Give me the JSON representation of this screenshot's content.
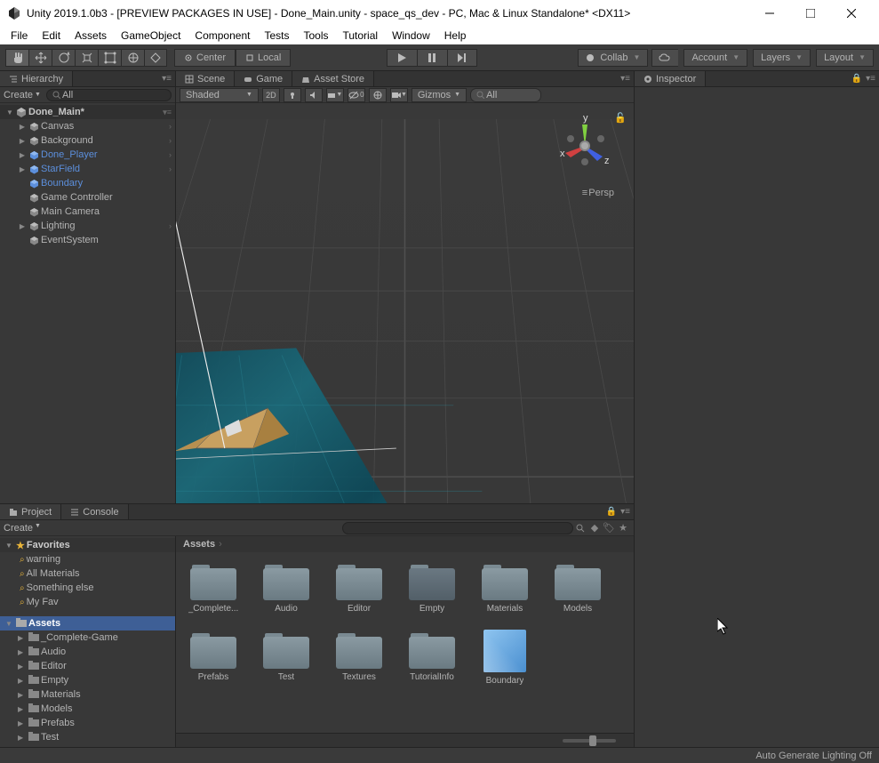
{
  "window": {
    "title": "Unity 2019.1.0b3 - [PREVIEW PACKAGES IN USE] - Done_Main.unity - space_qs_dev - PC, Mac & Linux Standalone* <DX11>"
  },
  "menu": [
    "File",
    "Edit",
    "Assets",
    "GameObject",
    "Component",
    "Tests",
    "Tools",
    "Tutorial",
    "Window",
    "Help"
  ],
  "toolbar": {
    "center": "Center",
    "local": "Local",
    "collab": "Collab",
    "account": "Account",
    "layers": "Layers",
    "layout": "Layout"
  },
  "hierarchy": {
    "tab": "Hierarchy",
    "create": "Create",
    "searchAll": "All",
    "root": "Done_Main*",
    "items": [
      {
        "label": "Canvas",
        "blue": false,
        "hasChildren": true
      },
      {
        "label": "Background",
        "blue": false,
        "hasChildren": true
      },
      {
        "label": "Done_Player",
        "blue": true,
        "hasChildren": true
      },
      {
        "label": "StarField",
        "blue": true,
        "hasChildren": true
      },
      {
        "label": "Boundary",
        "blue": true,
        "hasChildren": false
      },
      {
        "label": "Game Controller",
        "blue": false,
        "hasChildren": false
      },
      {
        "label": "Main Camera",
        "blue": false,
        "hasChildren": false
      },
      {
        "label": "Lighting",
        "blue": false,
        "hasChildren": true
      },
      {
        "label": "EventSystem",
        "blue": false,
        "hasChildren": false
      }
    ]
  },
  "scene": {
    "tabs": [
      "Scene",
      "Game",
      "Asset Store"
    ],
    "shaded": "Shaded",
    "mode2d": "2D",
    "gizmos": "Gizmos",
    "searchAll": "All",
    "persp": "Persp"
  },
  "project": {
    "tabs": [
      "Project",
      "Console"
    ],
    "create": "Create",
    "favorites": "Favorites",
    "favItems": [
      "warning",
      "All Materials",
      "Something else",
      "My Fav"
    ],
    "assetsLabel": "Assets",
    "tree": [
      "_Complete-Game",
      "Audio",
      "Editor",
      "Empty",
      "Materials",
      "Models",
      "Prefabs",
      "Test"
    ],
    "breadcrumb": "Assets",
    "gridItems": [
      {
        "label": "_Complete...",
        "type": "folder"
      },
      {
        "label": "Audio",
        "type": "folder"
      },
      {
        "label": "Editor",
        "type": "folder"
      },
      {
        "label": "Empty",
        "type": "folder-empty"
      },
      {
        "label": "Materials",
        "type": "folder"
      },
      {
        "label": "Models",
        "type": "folder"
      },
      {
        "label": "Prefabs",
        "type": "folder"
      },
      {
        "label": "Test",
        "type": "folder"
      },
      {
        "label": "Textures",
        "type": "folder"
      },
      {
        "label": "TutorialInfo",
        "type": "folder"
      },
      {
        "label": "Boundary",
        "type": "prefab"
      }
    ]
  },
  "inspector": {
    "tab": "Inspector"
  },
  "status": {
    "lighting": "Auto Generate Lighting Off"
  },
  "gizmo": {
    "x": "x",
    "y": "y",
    "z": "z"
  }
}
